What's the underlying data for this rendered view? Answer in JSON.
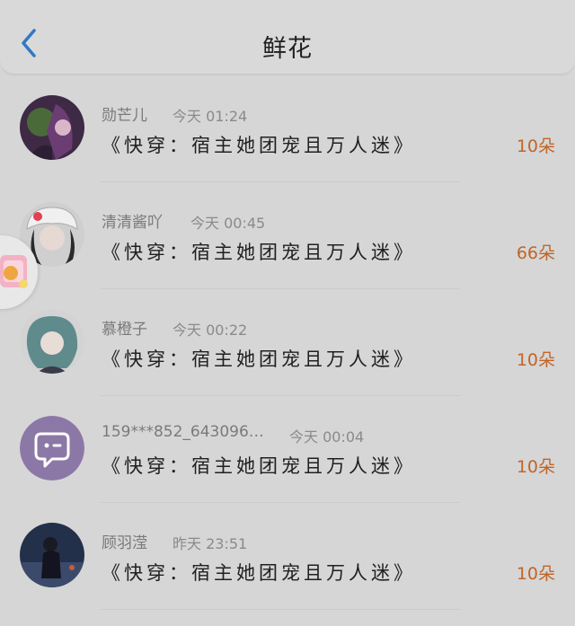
{
  "header": {
    "title": "鲜花",
    "back_icon": "chevron-left-icon",
    "accent": "#3a7bd5"
  },
  "items": [
    {
      "name": "勋芒儿",
      "time": "今天 01:24",
      "book": "《快穿：宿主她团宠且万人迷》",
      "count": "10朵",
      "avatar": "avatar-image"
    },
    {
      "name": "清清酱吖",
      "time": "今天 00:45",
      "book": "《快穿：宿主她团宠且万人迷》",
      "count": "66朵",
      "avatar": "avatar-image"
    },
    {
      "name": "慕橙子",
      "time": "今天 00:22",
      "book": "《快穿：宿主她团宠且万人迷》",
      "count": "10朵",
      "avatar": "avatar-image"
    },
    {
      "name": "159***852_643096…",
      "time": "今天 00:04",
      "book": "《快穿：宿主她团宠且万人迷》",
      "count": "10朵",
      "avatar": "default-chat-avatar-icon"
    },
    {
      "name": "顾羽滢",
      "time": "昨天 23:51",
      "book": "《快穿：宿主她团宠且万人迷》",
      "count": "10朵",
      "avatar": "avatar-image"
    }
  ],
  "floating_badge": {
    "icon": "gift-icon"
  }
}
